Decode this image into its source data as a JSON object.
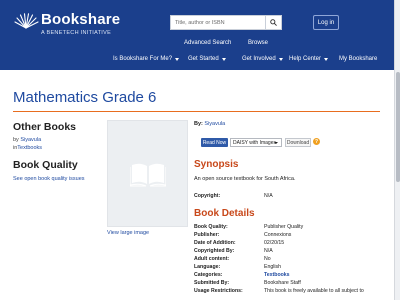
{
  "header": {
    "brand_name": "Bookshare",
    "brand_tagline": "A BENETECH INITIATIVE",
    "search_placeholder": "Title, author or ISBN",
    "login_label": "Log in",
    "subnav": [
      "Advanced Search",
      "Browse"
    ],
    "mainnav": [
      {
        "label": "Is Bookshare For Me?",
        "has_dropdown": true
      },
      {
        "label": "Get Started",
        "has_dropdown": true
      },
      {
        "label": "Get Involved",
        "has_dropdown": true
      },
      {
        "label": "Help Center",
        "has_dropdown": true
      },
      {
        "label": "My Bookshare",
        "has_dropdown": false
      }
    ]
  },
  "page": {
    "title": "Mathematics Grade 6"
  },
  "sidebar": {
    "other_books_heading": "Other Books",
    "by_prefix": "by",
    "author": "Siyavula",
    "in_prefix": "in",
    "category": "Textbooks",
    "book_quality_heading": "Book Quality",
    "quality_link": "See open book quality issues"
  },
  "book": {
    "view_large": "View large image",
    "by_label": "By:",
    "author": "Siyavula",
    "read_now": "Read Now",
    "format_selected": "DAISY with Images",
    "download": "Download",
    "help_glyph": "?"
  },
  "synopsis": {
    "heading": "Synopsis",
    "text": "An open source textbook for South Africa.",
    "copyright_label": "Copyright:",
    "copyright_value": "N/A"
  },
  "details": {
    "heading": "Book Details",
    "rows": [
      {
        "label": "Book Quality:",
        "value": "Publisher Quality",
        "link": false
      },
      {
        "label": "Publisher:",
        "value": "Connexions",
        "link": false
      },
      {
        "label": "Date of Addition:",
        "value": "02/20/15",
        "link": false
      },
      {
        "label": "Copyrighted By:",
        "value": "N/A",
        "link": false
      },
      {
        "label": "Adult content:",
        "value": "No",
        "link": false
      },
      {
        "label": "Language:",
        "value": "English",
        "link": false
      },
      {
        "label": "Categories:",
        "value": "Textbooks",
        "link": true
      },
      {
        "label": "Submitted By:",
        "value": "Bookshare Staff",
        "link": false
      },
      {
        "label": "Usage Restrictions:",
        "value": "This book is freely available to all subject to",
        "link": false
      }
    ]
  },
  "colors": {
    "header_bg": "#1b3f8c",
    "title_blue": "#1f4aa0",
    "accent_orange": "#c8481a",
    "rule_orange": "#e86d1f"
  },
  "icons": {
    "search": "search-icon",
    "book_placeholder": "open-book-icon",
    "logo": "bookshare-logo-icon"
  }
}
